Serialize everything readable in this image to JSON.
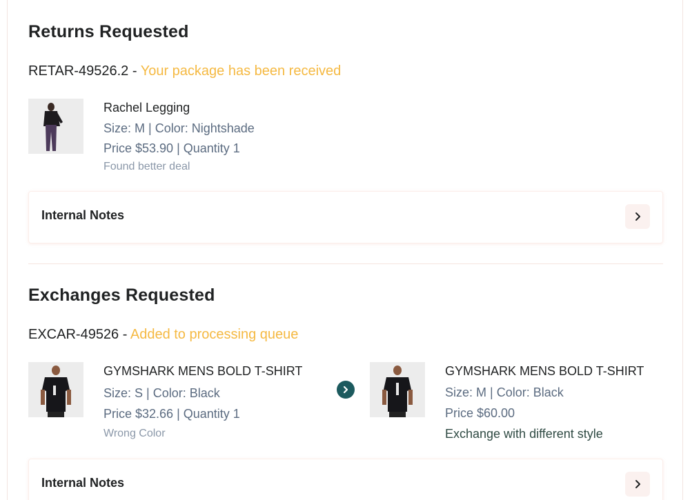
{
  "returns": {
    "title": "Returns Requested",
    "request_id": "RETAR-49526.2",
    "separator": " - ",
    "status": "Your package has been received",
    "item": {
      "image": "woman-legging-photo",
      "name": "Rachel Legging",
      "variant": "Size: M | Color: Nightshade",
      "price_qty": "Price $53.90 | Quantity 1",
      "reason": "Found better deal"
    },
    "notes_label": "Internal Notes"
  },
  "exchanges": {
    "title": "Exchanges Requested",
    "request_id": "EXCAR-49526",
    "separator": " - ",
    "status": "Added to processing queue",
    "original_item": {
      "image": "man-tshirt-photo",
      "name": "GYMSHARK MENS BOLD T-SHIRT",
      "variant": "Size: S | Color: Black",
      "price_qty": "Price $32.66 | Quantity 1",
      "reason": "Wrong Color"
    },
    "new_item": {
      "image": "man-tshirt-photo",
      "name": "GYMSHARK MENS BOLD T-SHIRT",
      "variant": "Size: M | Color: Black",
      "price": "Price $60.00",
      "note": "Exchange with different style"
    },
    "notes_label": "Internal Notes"
  },
  "colors": {
    "status": "#f5b942",
    "arrow": "#1c5a5e",
    "border": "#f3e4e0"
  }
}
